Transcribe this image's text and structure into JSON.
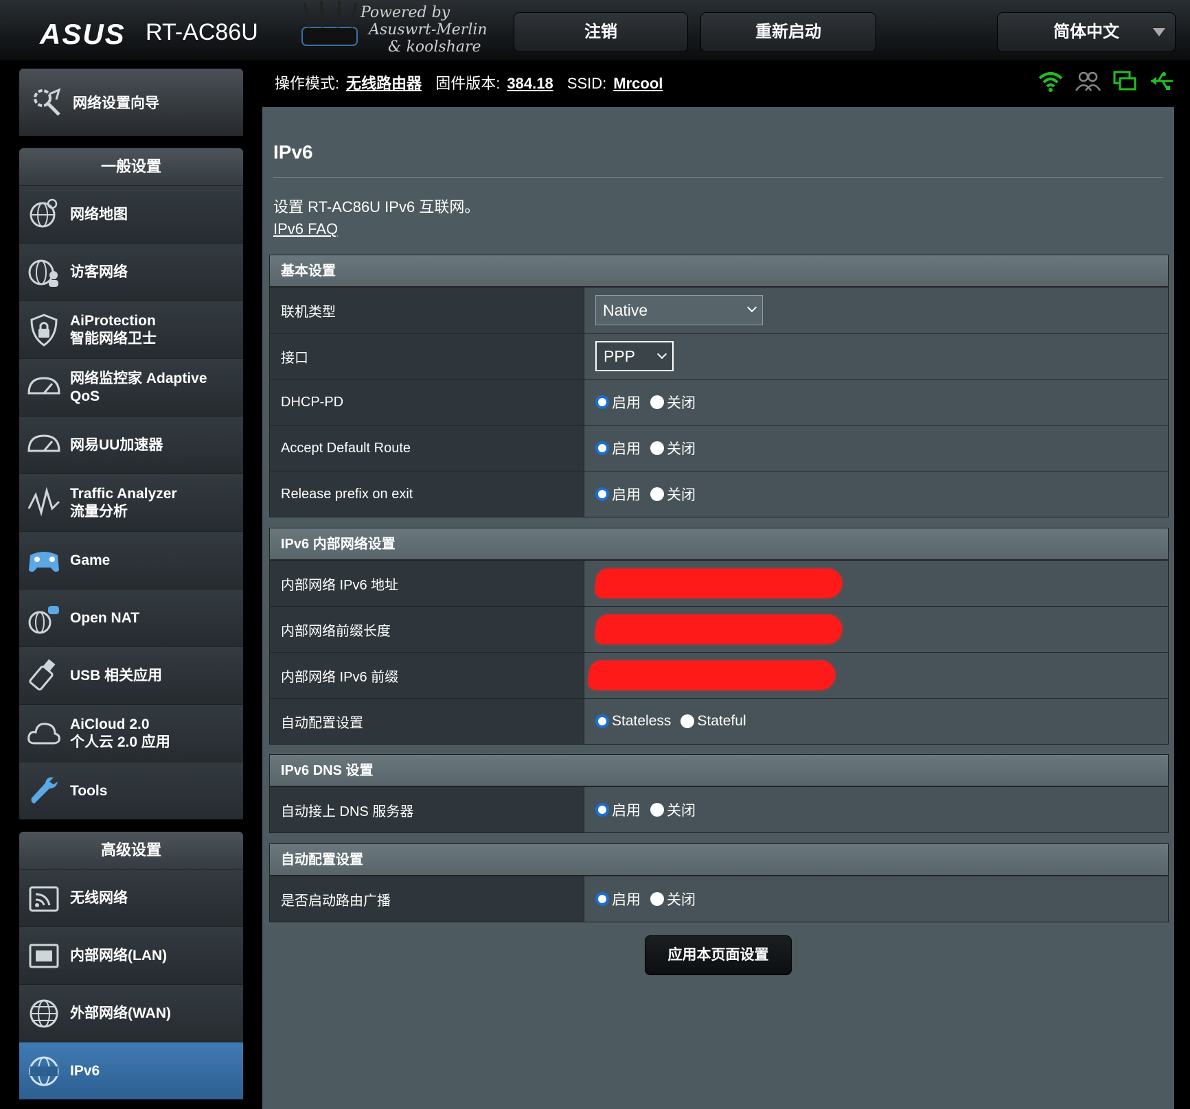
{
  "header": {
    "brand": "ASUS",
    "model": "RT-AC86U",
    "powered_line1": "Powered by",
    "powered_line2": "Asuswrt-Merlin",
    "powered_line3": "& koolshare",
    "logout_label": "注销",
    "reboot_label": "重新启动",
    "language": "简体中文"
  },
  "status": {
    "mode_label": "操作模式:",
    "mode_value": "无线路由器",
    "firmware_label": "固件版本:",
    "firmware_value": "384.18",
    "ssid_label": "SSID:",
    "ssid_value": "Mrcool",
    "icons": [
      "wifi-icon",
      "clients-icon",
      "network-icon",
      "usb-icon"
    ]
  },
  "sidebar": {
    "qis": "网络设置向导",
    "general_header": "一般设置",
    "general_items": [
      {
        "label": "网络地图",
        "icon": "globe-network-icon"
      },
      {
        "label": "访客网络",
        "icon": "guest-network-icon"
      },
      {
        "label": "AiProtection\n智能网络卫士",
        "icon": "shield-lock-icon"
      },
      {
        "label": "网络监控家 Adaptive\nQoS",
        "icon": "gauge-icon"
      },
      {
        "label": "网易UU加速器",
        "icon": "gauge-icon"
      },
      {
        "label": "Traffic Analyzer\n流量分析",
        "icon": "traffic-icon"
      },
      {
        "label": "Game",
        "icon": "gamepad-icon"
      },
      {
        "label": "Open NAT",
        "icon": "open-nat-icon"
      },
      {
        "label": "USB 相关应用",
        "icon": "usb-app-icon"
      },
      {
        "label": "AiCloud 2.0\n个人云 2.0 应用",
        "icon": "cloud-icon"
      },
      {
        "label": "Tools",
        "icon": "wrench-icon"
      }
    ],
    "advanced_header": "高级设置",
    "advanced_items": [
      {
        "label": "无线网络",
        "icon": "wireless-icon"
      },
      {
        "label": "内部网络(LAN)",
        "icon": "lan-icon"
      },
      {
        "label": "外部网络(WAN)",
        "icon": "wan-globe-icon"
      },
      {
        "label": "IPv6",
        "icon": "ipv6-icon",
        "active": true
      }
    ]
  },
  "content": {
    "title": "IPv6",
    "description": "设置 RT-AC86U IPv6 互联网。",
    "faq_link": "IPv6 FAQ",
    "basic": {
      "header": "基本设置",
      "conn_type_label": "联机类型",
      "conn_type_value": "Native",
      "interface_label": "接口",
      "interface_value": "PPP",
      "dhcp_pd_label": "DHCP-PD",
      "accept_route_label": "Accept Default Route",
      "release_prefix_label": "Release prefix on exit"
    },
    "lan": {
      "header": "IPv6 内部网络设置",
      "addr_label": "内部网络 IPv6 地址",
      "prefix_len_label": "内部网络前缀长度",
      "prefix_label": "内部网络 IPv6 前缀",
      "autoconf_label": "自动配置设置",
      "stateless": "Stateless",
      "stateful": "Stateful"
    },
    "dns": {
      "header": "IPv6 DNS 设置",
      "auto_dns_label": "自动接上 DNS 服务器"
    },
    "autoconf": {
      "header": "自动配置设置",
      "ra_label": "是否启动路由广播"
    },
    "enable": "启用",
    "disable": "关闭",
    "apply_label": "应用本页面设置"
  },
  "colors": {
    "accent_blue": "#1a6fd6",
    "active_menu": "#3f7bb4",
    "status_green": "#20c020",
    "redaction": "#ff1a1a"
  }
}
